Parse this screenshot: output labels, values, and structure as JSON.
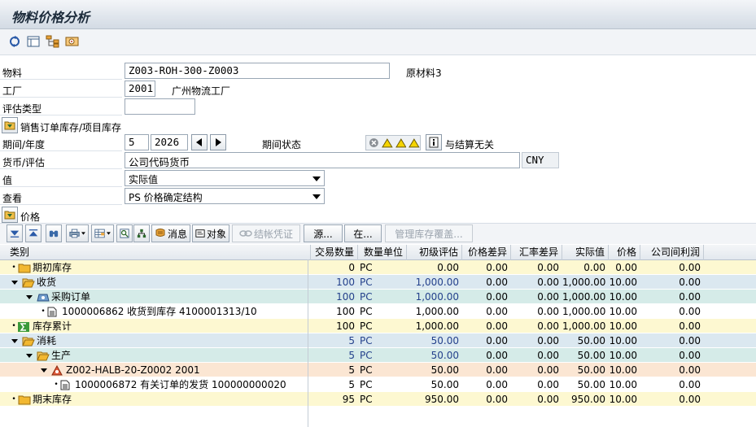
{
  "window": {
    "title": "物料价格分析"
  },
  "form": {
    "material": {
      "label": "物料",
      "value": "Z003-ROH-300-Z0003",
      "description": "原材料3"
    },
    "plant": {
      "label": "工厂",
      "value": "2001",
      "description": "广州物流工厂"
    },
    "valuation_type": {
      "label": "评估类型",
      "value": ""
    },
    "sales_order_stock": {
      "label": "销售订单库存/项目库存"
    },
    "period_year": {
      "label": "期间/年度",
      "period": "5",
      "year": "2026"
    },
    "period_status": {
      "label": "期间状态",
      "text": "与结算无关"
    },
    "currency": {
      "label": "货币/评估",
      "value": "公司代码货币",
      "code": "CNY"
    },
    "value": {
      "label": "值",
      "selected": "实际值"
    },
    "view": {
      "label": "查看",
      "selected": "PS 价格确定结构"
    },
    "price": {
      "label": "价格"
    }
  },
  "grid_toolbar": {
    "messages": "消息",
    "objects": "对象",
    "post_closing": "结帐凭证",
    "source": "源...",
    "in": "在...",
    "manage_coverage": "管理库存覆盖..."
  },
  "columns": [
    "类别",
    "交易数量",
    "数量单位",
    "初级评估",
    "价格差异",
    "汇率差异",
    "实际值",
    "价格",
    "公司间利润"
  ],
  "rows": [
    {
      "label": "期初库存",
      "qty": "0",
      "unit": "PC",
      "primary": "0.00",
      "price_diff": "0.00",
      "fx_diff": "0.00",
      "actual": "0.00",
      "price": "0.00",
      "ic": "0.00"
    },
    {
      "label": "收货",
      "qty": "100",
      "unit": "PC",
      "primary": "1,000.00",
      "price_diff": "0.00",
      "fx_diff": "0.00",
      "actual": "1,000.00",
      "price": "10.00",
      "ic": "0.00"
    },
    {
      "label": "采购订单",
      "qty": "100",
      "unit": "PC",
      "primary": "1,000.00",
      "price_diff": "0.00",
      "fx_diff": "0.00",
      "actual": "1,000.00",
      "price": "10.00",
      "ic": "0.00"
    },
    {
      "label": "1000006862 收货到库存 4100001313/10",
      "qty": "100",
      "unit": "PC",
      "primary": "1,000.00",
      "price_diff": "0.00",
      "fx_diff": "0.00",
      "actual": "1,000.00",
      "price": "10.00",
      "ic": "0.00"
    },
    {
      "label": "库存累计",
      "qty": "100",
      "unit": "PC",
      "primary": "1,000.00",
      "price_diff": "0.00",
      "fx_diff": "0.00",
      "actual": "1,000.00",
      "price": "10.00",
      "ic": "0.00"
    },
    {
      "label": "消耗",
      "qty": "5",
      "unit": "PC",
      "primary": "50.00",
      "price_diff": "0.00",
      "fx_diff": "0.00",
      "actual": "50.00",
      "price": "10.00",
      "ic": "0.00"
    },
    {
      "label": "生产",
      "qty": "5",
      "unit": "PC",
      "primary": "50.00",
      "price_diff": "0.00",
      "fx_diff": "0.00",
      "actual": "50.00",
      "price": "10.00",
      "ic": "0.00"
    },
    {
      "label": "Z002-HALB-20-Z0002 2001",
      "qty": "5",
      "unit": "PC",
      "primary": "50.00",
      "price_diff": "0.00",
      "fx_diff": "0.00",
      "actual": "50.00",
      "price": "10.00",
      "ic": "0.00"
    },
    {
      "label": "1000006872 有关订单的发货 100000000020",
      "qty": "5",
      "unit": "PC",
      "primary": "50.00",
      "price_diff": "0.00",
      "fx_diff": "0.00",
      "actual": "50.00",
      "price": "10.00",
      "ic": "0.00"
    },
    {
      "label": "期末库存",
      "qty": "95",
      "unit": "PC",
      "primary": "950.00",
      "price_diff": "0.00",
      "fx_diff": "0.00",
      "actual": "950.00",
      "price": "10.00",
      "ic": "0.00"
    }
  ],
  "colors": {
    "yellow_row": "#fdf8d1",
    "blue_row": "#dbe8f0",
    "teal_row": "#d5ebe8",
    "orange_row": "#fbe6d3",
    "value_blue": "#24418c"
  }
}
